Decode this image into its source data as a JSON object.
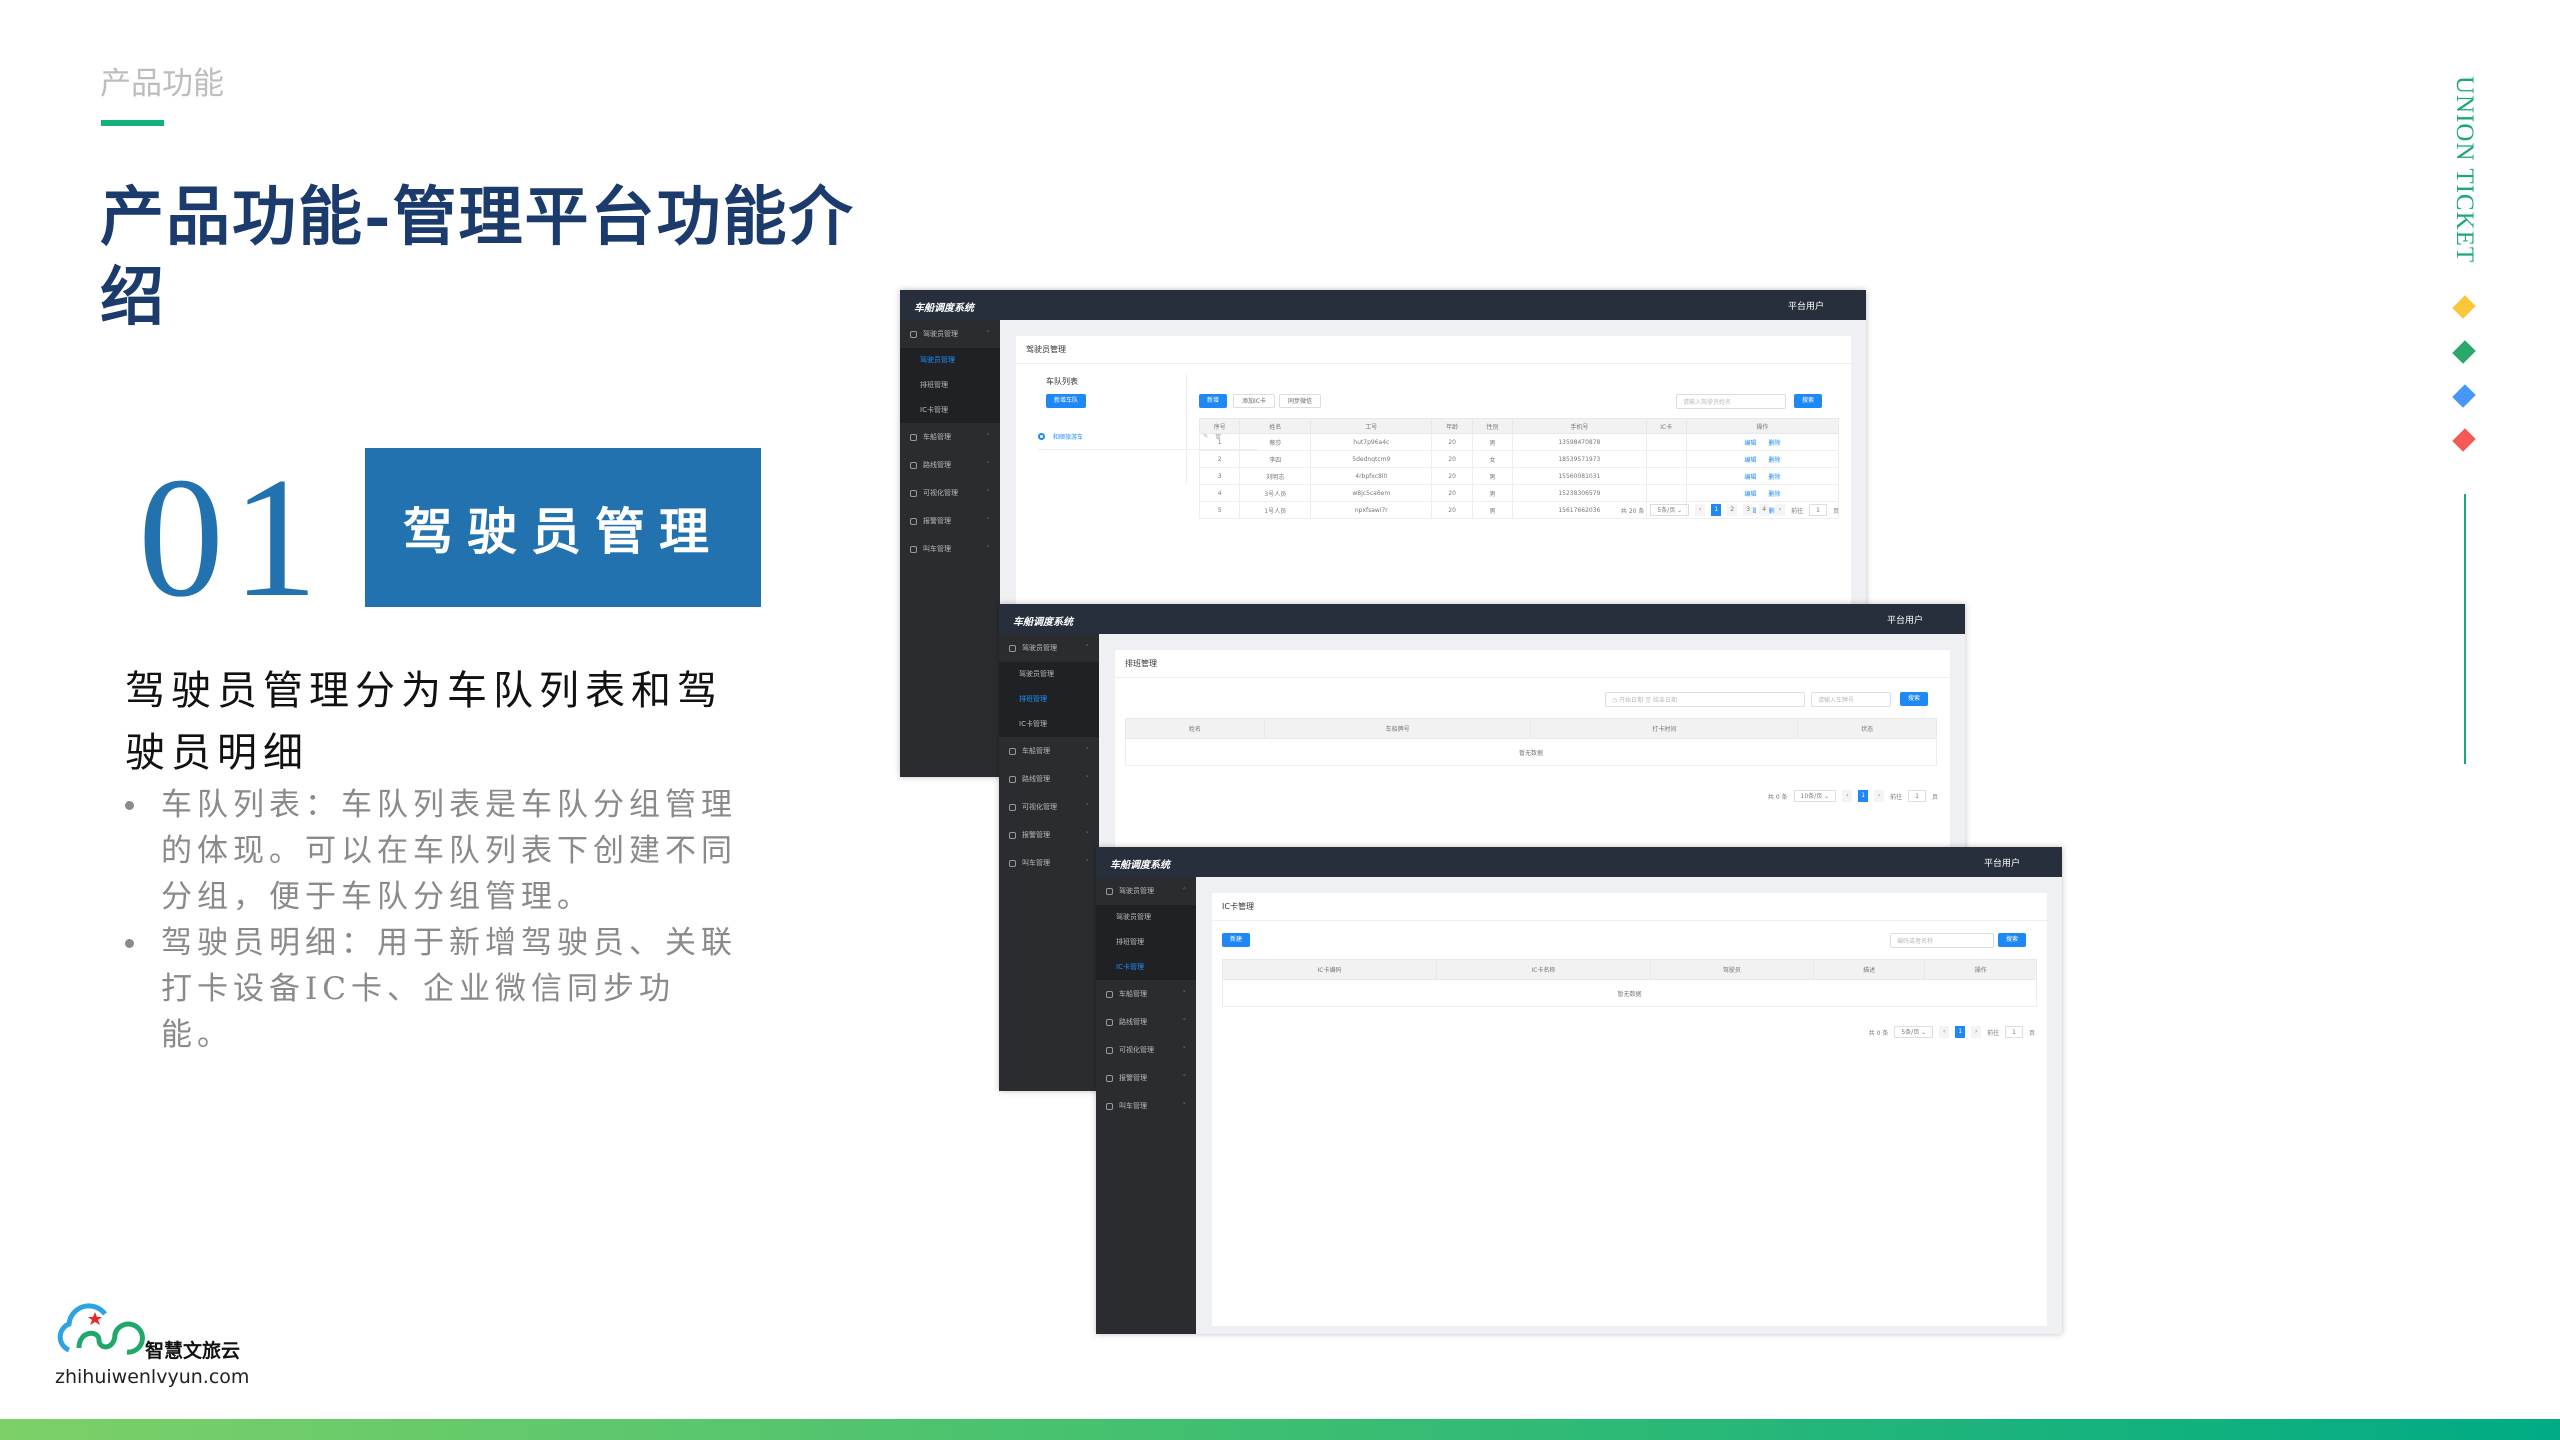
{
  "slide": {
    "section_label": "产品功能",
    "title": "产品功能-管理平台功能介绍",
    "number": "01",
    "badge": "驾驶员管理",
    "lead": "驾驶员管理分为车队列表和驾驶员明细",
    "bullets": [
      "车队列表：车队列表是车队分组管理的体现。可以在车队列表下创建不同分组，便于车队分组管理。",
      "驾驶员明细：用于新增驾驶员、关联打卡设备IC卡、企业微信同步功能。"
    ],
    "side_text": "UNION TICKET",
    "diamond_colors": [
      "#fcc63a",
      "#2aa86a",
      "#4797f8",
      "#f55a56"
    ],
    "accent_color": "#13b27a",
    "title_color": "#1a3b6c",
    "badge_color": "#2272b0"
  },
  "logo": {
    "name": "智慧文旅云",
    "domain": "zhihuiwenlvyun.com"
  },
  "app": {
    "title": "车船调度系统",
    "user": "平台用户",
    "menu": [
      {
        "label": "驾驶员管理",
        "icon": "user-icon",
        "sub": [
          "驾驶员管理",
          "排班管理",
          "IC卡管理"
        ]
      },
      {
        "label": "车船管理",
        "icon": "vehicle-icon"
      },
      {
        "label": "路线管理",
        "icon": "route-icon"
      },
      {
        "label": "可视化管理",
        "icon": "chart-icon"
      },
      {
        "label": "报警管理",
        "icon": "alarm-icon"
      },
      {
        "label": "叫车管理",
        "icon": "call-car-icon"
      }
    ]
  },
  "screens": [
    {
      "active_sub": 0,
      "card_title": "驾驶员管理",
      "fleet": {
        "title": "车队列表",
        "add_button": "新增车队",
        "items": [
          "和顺旅游车"
        ]
      },
      "buttons": [
        "新增",
        "添加IC卡",
        "同步微信"
      ],
      "search_placeholder": "请输入驾驶员姓名",
      "search_button": "搜索",
      "columns": [
        "序号",
        "姓名",
        "工号",
        "年龄",
        "性别",
        "手机号",
        "IC卡",
        "操作"
      ],
      "rows": [
        [
          "1",
          "蔡莎",
          "hut7p96a4c",
          "20",
          "男",
          "13598470878",
          ""
        ],
        [
          "2",
          "李四",
          "5dednqtcm9",
          "20",
          "女",
          "18539571973",
          ""
        ],
        [
          "3",
          "刘明志",
          "4rbpfxc8l0",
          "20",
          "男",
          "15560081031",
          ""
        ],
        [
          "4",
          "3号人员",
          "w8jc5ca6em",
          "20",
          "男",
          "15238306579",
          ""
        ],
        [
          "5",
          "1号人员",
          "npxfsawi7r",
          "20",
          "男",
          "15617662036",
          ""
        ]
      ],
      "row_actions": [
        "编辑",
        "删除"
      ],
      "pager": {
        "total": "共 20 条",
        "size": "5条/页",
        "pages": [
          "1",
          "2",
          "3",
          "4"
        ],
        "current": "1",
        "goto": "前往",
        "goto_value": "1",
        "unit": "页"
      }
    },
    {
      "active_sub": 1,
      "card_title": "排班管理",
      "start_placeholder": "开始日期",
      "range_sep": "至",
      "end_placeholder": "结束日期",
      "search_placeholder": "请输入车牌号",
      "search_button": "搜索",
      "columns": [
        "姓名",
        "车船牌号",
        "打卡时间",
        "状态"
      ],
      "empty_text": "暂无数据",
      "pager": {
        "total": "共 0 条",
        "size": "10条/页",
        "pages": [
          "1"
        ],
        "current": "1",
        "goto": "前往",
        "goto_value": "1",
        "unit": "页"
      }
    },
    {
      "active_sub": 2,
      "card_title": "IC卡管理",
      "add_button": "新建",
      "search_placeholder": "编码或者名称",
      "search_button": "搜索",
      "columns": [
        "IC卡编码",
        "IC卡名称",
        "驾驶员",
        "描述",
        "操作"
      ],
      "empty_text": "暂无数据",
      "pager": {
        "total": "共 0 条",
        "size": "5条/页",
        "pages": [
          "1"
        ],
        "current": "1",
        "goto": "前往",
        "goto_value": "1",
        "unit": "页"
      }
    }
  ]
}
